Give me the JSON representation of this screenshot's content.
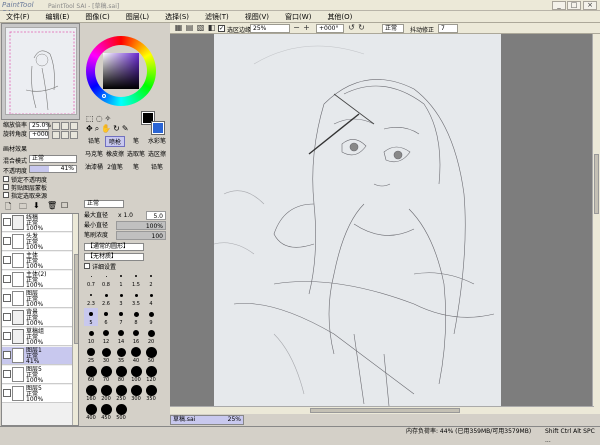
{
  "window": {
    "app_name": "PaintTool SAI",
    "file_title": "PaintTool SAI - [草稿.sai]"
  },
  "menu": [
    "文件(F)",
    "编辑(E)",
    "图像(C)",
    "图层(L)",
    "选择(S)",
    "滤镜(T)",
    "视图(V)",
    "窗口(W)",
    "其他(O)"
  ],
  "toolbar": {
    "selection_label": "选区边缘",
    "zoom": "25%",
    "angle": "+000°",
    "blend": "正常",
    "stabilizer_label": "抖动修正",
    "stabilizer_value": "7"
  },
  "navigator": {
    "zoom_label": "缩放倍率",
    "zoom_value": "25.0%",
    "angle_label": "旋转角度",
    "angle_value": "+000"
  },
  "layer_props": {
    "effect_label": "画材效果",
    "blend_label": "混合模式",
    "blend_value": "正常",
    "opacity_label": "不透明度",
    "opacity_value": "41%",
    "options": [
      "锁定不透明度",
      "剪贴图层蒙板",
      "指定选取来源"
    ]
  },
  "layers": [
    {
      "name": "线稿",
      "mode": "正常",
      "opacity": "100%",
      "folder": true
    },
    {
      "name": "头发",
      "mode": "正常",
      "opacity": "100%"
    },
    {
      "name": "主体",
      "mode": "正常",
      "opacity": "100%"
    },
    {
      "name": "主体(2)",
      "mode": "正常",
      "opacity": "100%"
    },
    {
      "name": "图层",
      "mode": "正常",
      "opacity": "100%"
    },
    {
      "name": "背景",
      "mode": "正常",
      "opacity": "100%",
      "folder": true
    },
    {
      "name": "草稿组",
      "mode": "正常",
      "opacity": "100%",
      "folder": true
    },
    {
      "name": "图层1",
      "mode": "正常",
      "opacity": "41%",
      "selected": true
    },
    {
      "name": "图层5",
      "mode": "正常",
      "opacity": "100%"
    },
    {
      "name": "图层5",
      "mode": "正常",
      "opacity": "100%"
    }
  ],
  "tools": [
    "铅笔",
    "喷枪",
    "笔",
    "水彩笔",
    "马克笔",
    "橡皮擦",
    "选取笔",
    "选区擦",
    "油漆桶",
    "2值笔",
    "笔",
    "铅笔"
  ],
  "brush": {
    "blend": "正常",
    "size_label": "最大直径",
    "size_mult": "x 1.0",
    "size_value": "5.0",
    "min_label": "最小直径",
    "min_value": "100%",
    "density_label": "笔刷浓度",
    "density_value": "100",
    "shape_label": "【通常的圆形】",
    "texture_label": "【无材质】",
    "detail_label": "详细设置"
  },
  "brush_sizes": [
    "0.7",
    "0.8",
    "1",
    "1.5",
    "2",
    "2.3",
    "2.6",
    "3",
    "3.5",
    "4",
    "5",
    "6",
    "7",
    "8",
    "9",
    "10",
    "12",
    "14",
    "16",
    "20",
    "25",
    "30",
    "35",
    "40",
    "50",
    "60",
    "70",
    "80",
    "100",
    "120",
    "160",
    "200",
    "250",
    "300",
    "350",
    "400",
    "450",
    "500"
  ],
  "colors": {
    "primary": "#000000",
    "secondary": "#2a64d4",
    "accent_selection": "#c8c8ee"
  },
  "status": {
    "file_name": "草稿.sai",
    "file_zoom": "25%",
    "memory": "内存负荷率: 44% (已用359MB/可用3579MB)",
    "keys": "Shift Ctrl Alt SPC ..."
  }
}
